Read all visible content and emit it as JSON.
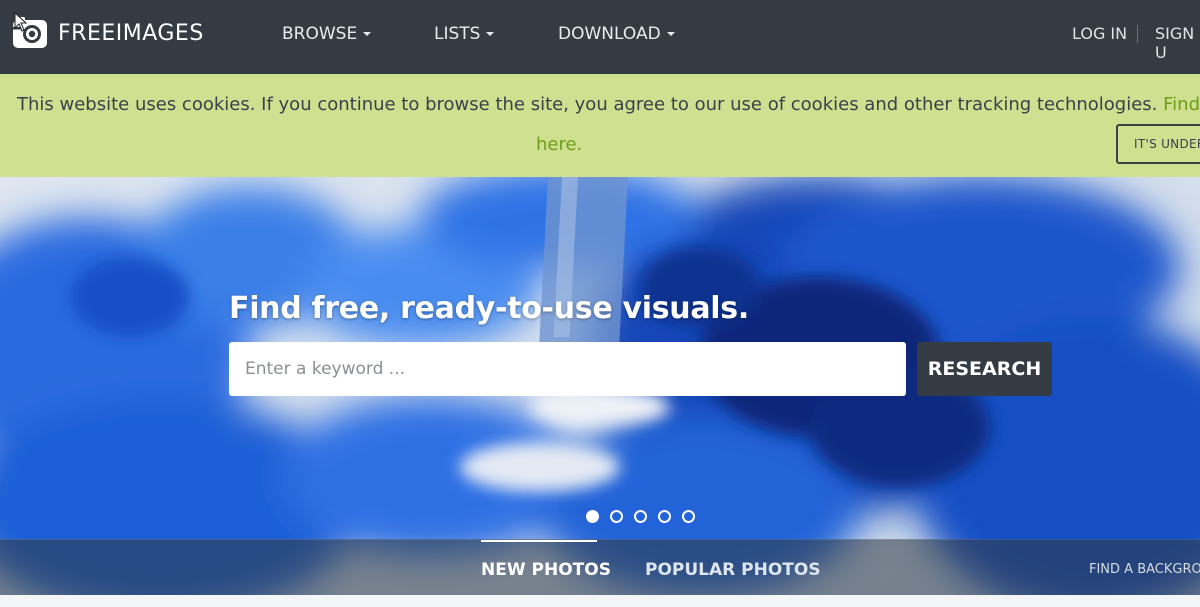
{
  "nav": {
    "logo_text": "FREEIMAGES",
    "logo_icon": "camera-icon",
    "menu": [
      {
        "label": "BROWSE"
      },
      {
        "label": "LISTS"
      },
      {
        "label": "DOWNLOAD"
      }
    ],
    "login": "LOG IN",
    "signup": "SIGN U"
  },
  "cookie_banner": {
    "text": "This website uses cookies. If you continue to browse the site, you agree to our use of cookies and other tracking technologies.",
    "link_part1": "Find ou",
    "link_part2": "here.",
    "button": "IT'S UNDER"
  },
  "hero": {
    "title": "Find free, ready-to-use visuals.",
    "search_placeholder": "Enter a keyword ...",
    "search_button": "RESEARCH",
    "slides": 5,
    "active_slide": 1
  },
  "tabs": {
    "new_photos": "NEW PHOTOS",
    "popular_photos": "POPULAR PHOTOS",
    "find_background": "FIND A BACKGROU"
  },
  "colors": {
    "nav_bg": "#353b43",
    "banner_bg": "#cfe090",
    "link_green": "#6e9e1a",
    "button_dark": "#353b43"
  }
}
